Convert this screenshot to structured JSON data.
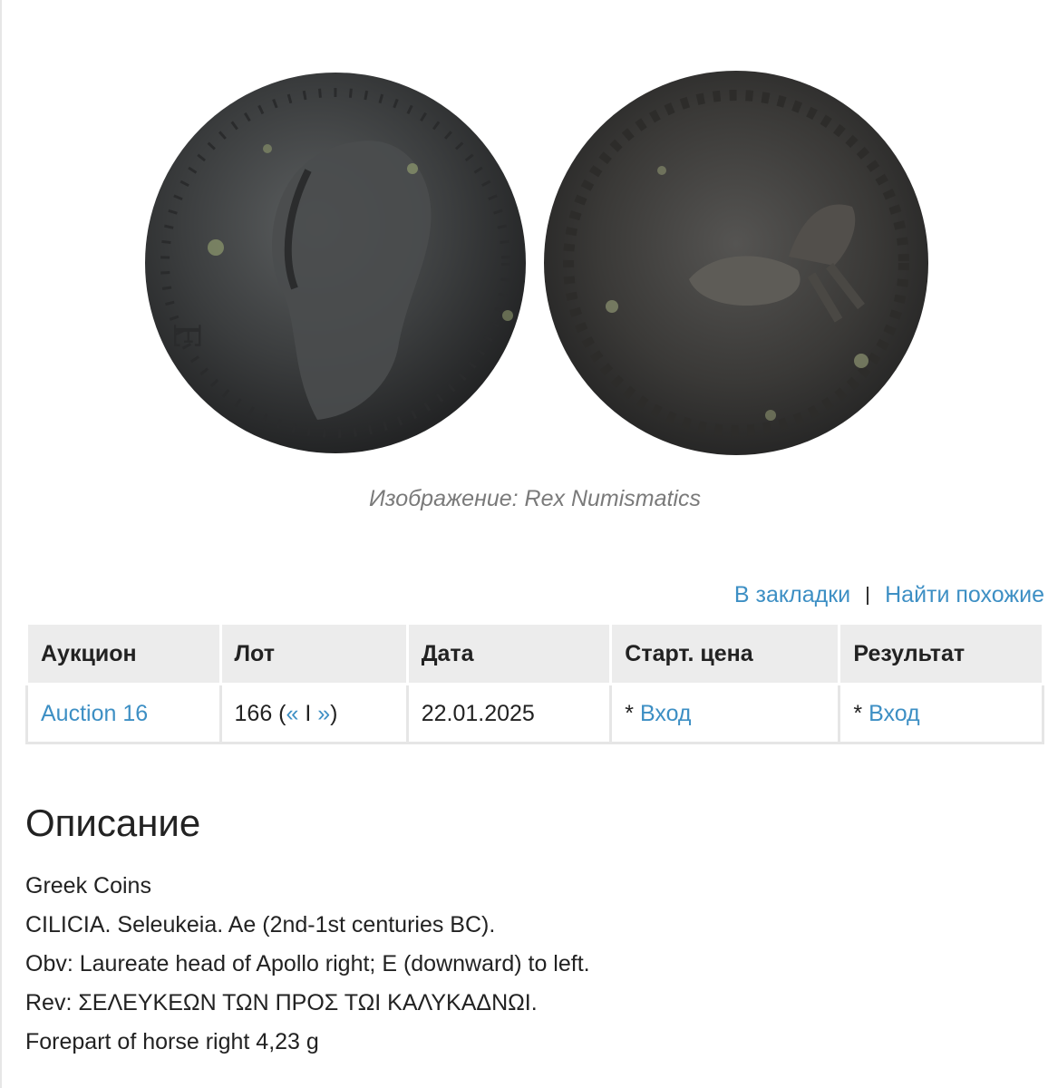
{
  "image": {
    "obverse": "Laureate head of Apollo right coin obverse",
    "reverse": "Forepart of horse right coin reverse"
  },
  "caption": "Изображение: Rex Numismatics",
  "actions": {
    "bookmark": "В закладки",
    "separator": "I",
    "find_similar": "Найти похожие"
  },
  "table": {
    "headers": [
      "Аукцион",
      "Лот",
      "Дата",
      "Старт. цена",
      "Результат"
    ],
    "row": {
      "auction": "Auction 16",
      "lot_number": "166 (",
      "lot_prev": "«",
      "lot_sep": " I ",
      "lot_next": "»",
      "lot_close": ")",
      "date": "22.01.2025",
      "start_prefix": "* ",
      "start_link": "Вход",
      "result_prefix": "* ",
      "result_link": "Вход"
    }
  },
  "description": {
    "title": "Описание",
    "lines": [
      "Greek Coins",
      "CILICIA. Seleukeia. Ae (2nd-1st centuries BC).",
      "Obv: Laureate head of Apollo right; E (downward) to left.",
      "Rev: ΣΕΛΕΥΚΕΩΝ ΤΩΝ ΠΡΟΣ ΤΩΙ ΚΑΛΥΚΑΔΝΩΙ.",
      "Forepart of horse right 4,23 g"
    ]
  },
  "colors": {
    "link": "#3d8fc4",
    "header_bg": "#ececec",
    "caption": "#7a7a7a"
  }
}
